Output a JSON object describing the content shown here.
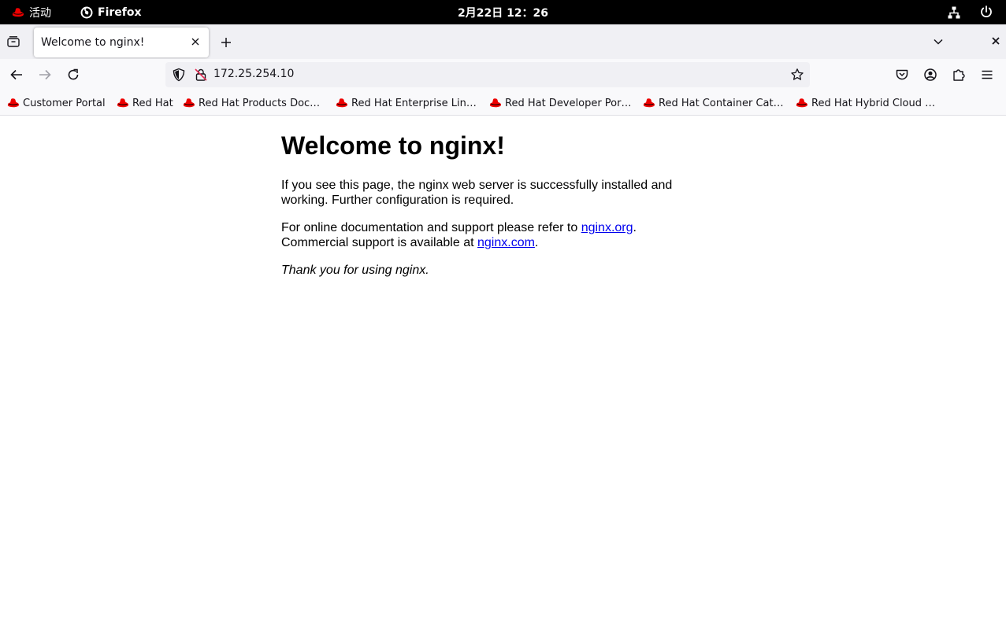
{
  "topbar": {
    "activities_label": "活动",
    "app_label": "Firefox",
    "clock": "2月22日  12：26"
  },
  "browser": {
    "tab": {
      "title": "Welcome to nginx!"
    },
    "address_bar": {
      "url": "172.25.254.10"
    },
    "bookmarks": [
      "Customer Portal",
      "Red Hat",
      "Red Hat Products Doc…",
      "Red Hat Enterprise Lin…",
      "Red Hat Developer Por…",
      "Red Hat Container Cat…",
      "Red Hat Hybrid Cloud …"
    ]
  },
  "content": {
    "heading": "Welcome to nginx!",
    "p1": "If you see this page, the nginx web server is successfully installed and working. Further configuration is required.",
    "p2_prefix": "For online documentation and support please refer to ",
    "p2_link1": "nginx.org",
    "p2_mid": ".",
    "p2_line2": "Commercial support is available at ",
    "p2_link2": "nginx.com",
    "p2_end": ".",
    "p3": "Thank you for using nginx."
  },
  "colors": {
    "link": "#0000ee",
    "redhat": "#ee0000",
    "topbar_bg": "#000000"
  }
}
